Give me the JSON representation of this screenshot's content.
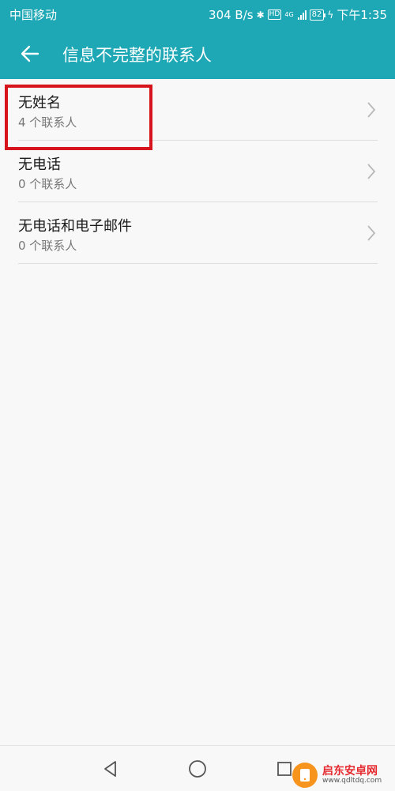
{
  "status_bar": {
    "carrier": "中国移动",
    "net_speed": "304 B/s",
    "hd": "HD",
    "net_type": "4G",
    "battery": "82",
    "time": "下午1:35"
  },
  "app_bar": {
    "title": "信息不完整的联系人",
    "back_icon": "arrow-left-icon"
  },
  "items": [
    {
      "label": "无姓名",
      "count": "4 个联系人"
    },
    {
      "label": "无电话",
      "count": "0 个联系人"
    },
    {
      "label": "无电话和电子邮件",
      "count": "0 个联系人"
    }
  ],
  "nav_bar": {
    "back": "triangle-back-icon",
    "home": "circle-home-icon",
    "recents": "square-recents-icon"
  },
  "watermark": {
    "name": "启东安卓网",
    "url": "www.qdltdq.com"
  },
  "colors": {
    "accent": "#1ea8b5",
    "highlight": "#d7131b"
  }
}
